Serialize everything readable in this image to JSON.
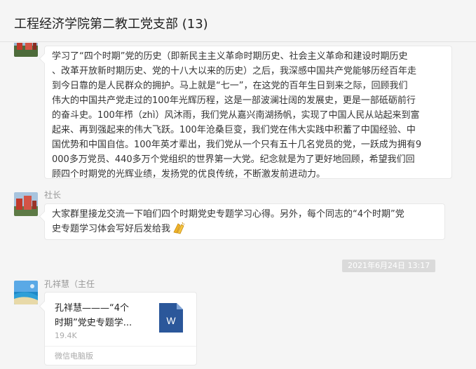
{
  "header": {
    "title": "工程经济学院第二教工党支部 (13)"
  },
  "messages": {
    "history_study": {
      "lines": [
        "学习了“四个时期”党的历史（即新民主主义革命时期历史、社会主义革命和建设时期历史",
        "、改革开放新时期历史、党的十八大以来的历史）之后，我深感中国共产党能够历经百年走",
        "到今日靠的是人民群众的拥护。马上就是“七一”，在这党的百年生日到来之际，回顾我们",
        "伟大的中国共产党走过的100年光辉历程，这是一部波澜壮阔的发展史，更是一部砥砺前行",
        "的奋斗史。100年栉（zhì）风沐雨，我们党从嘉兴南湖扬帆，实现了中国人民从站起来到富",
        "起来、再到强起来的伟大飞跃。100年沧桑巨变，我们党在伟大实践中积蓄了中国经验、中",
        "国优势和中国自信。100年英才辈出，我们党从一个只有五十几名党员的党，一跃成为拥有9",
        "000多万党员、440多万个党组织的世界第一大党。纪念就是为了更好地回顾，希望我们回",
        "顾四个时期党的光辉业绩，发扬党的优良传统，不断激发前进动力。"
      ]
    },
    "president": {
      "sender": "社长",
      "lines": [
        "大家群里接龙交流一下咱们四个时期党史专题学习心得。另外，每个同志的“4个时期”党",
        "史专题学习体会写好后发给我"
      ],
      "emoji": "applause-emoji"
    },
    "timestamp": "2021年6月24日 13:17",
    "file_message": {
      "sender": "孔祥慧（主任",
      "file_name_lines": [
        "孔祥慧———“4个",
        "时期”党史专题学..."
      ],
      "file_size": "19.4K",
      "source": "微信电脑版",
      "icon": "word-doc-icon",
      "icon_letter": "W"
    }
  },
  "colors": {
    "word_blue": "#2b579a",
    "timestamp_bg": "#dadada"
  }
}
